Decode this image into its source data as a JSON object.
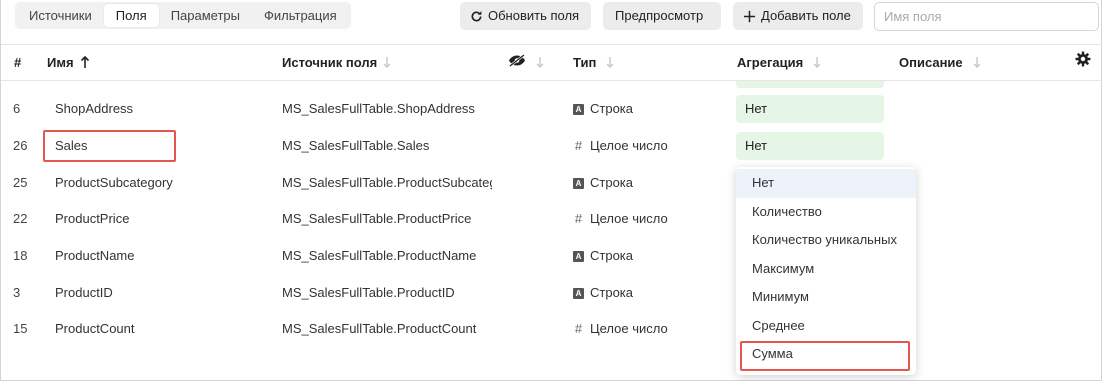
{
  "tabs": [
    {
      "label": "Источники",
      "active": false
    },
    {
      "label": "Поля",
      "active": true
    },
    {
      "label": "Параметры",
      "active": false
    },
    {
      "label": "Фильтрация",
      "active": false
    }
  ],
  "toolbar": {
    "refresh_label": "Обновить поля",
    "preview_label": "Предпросмотр",
    "add_field_label": "Добавить поле",
    "search_placeholder": "Имя поля",
    "search_value": ""
  },
  "columns": {
    "num": "#",
    "name": "Имя",
    "source": "Источник поля",
    "type": "Тип",
    "aggregation": "Агрегация",
    "description": "Описание"
  },
  "rows": [
    {
      "num": "6",
      "name": "ShopAddress",
      "source": "MS_SalesFullTable.ShopAddress",
      "type": "Строка",
      "type_icon": "string-type-icon",
      "aggregation": "Нет"
    },
    {
      "num": "26",
      "name": "Sales",
      "source": "MS_SalesFullTable.Sales",
      "type": "Целое число",
      "type_icon": "integer-type-icon",
      "aggregation": "Нет"
    },
    {
      "num": "25",
      "name": "ProductSubcategory",
      "source": "MS_SalesFullTable.ProductSubcategory",
      "type": "Строка",
      "type_icon": "string-type-icon",
      "aggregation": ""
    },
    {
      "num": "22",
      "name": "ProductPrice",
      "source": "MS_SalesFullTable.ProductPrice",
      "type": "Целое число",
      "type_icon": "integer-type-icon",
      "aggregation": ""
    },
    {
      "num": "18",
      "name": "ProductName",
      "source": "MS_SalesFullTable.ProductName",
      "type": "Строка",
      "type_icon": "string-type-icon",
      "aggregation": ""
    },
    {
      "num": "3",
      "name": "ProductID",
      "source": "MS_SalesFullTable.ProductID",
      "type": "Строка",
      "type_icon": "string-type-icon",
      "aggregation": ""
    },
    {
      "num": "15",
      "name": "ProductCount",
      "source": "MS_SalesFullTable.ProductCount",
      "type": "Целое число",
      "type_icon": "integer-type-icon",
      "aggregation": ""
    }
  ],
  "aggregation_dropdown": {
    "options": [
      "Нет",
      "Количество",
      "Количество уникальных",
      "Максимум",
      "Минимум",
      "Среднее",
      "Сумма"
    ],
    "selected": "Нет",
    "highlighted": "Сумма"
  },
  "type_icon_letter": "A",
  "colors": {
    "highlight": "#e4574f",
    "aggregation_bg": "#e6f6e6",
    "selected_option_bg": "#eef2fb"
  }
}
